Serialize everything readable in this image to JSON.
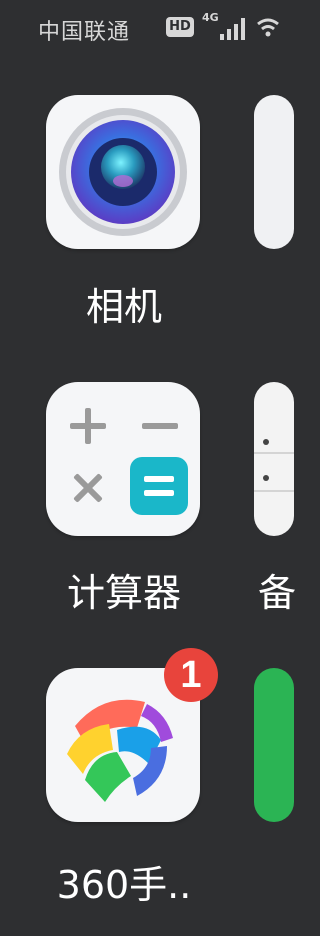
{
  "status_bar": {
    "carrier": "中国联通",
    "hd_badge": "HD",
    "network_type": "4G",
    "signal_icon": "signal-bars-icon",
    "wifi_icon": "wifi-icon"
  },
  "apps": [
    {
      "label": "相机",
      "icon": "camera-icon"
    },
    {
      "label": "计算器",
      "icon": "calculator-icon"
    },
    {
      "label": "360手..",
      "icon": "360-app-icon",
      "badge": "1"
    }
  ],
  "partial_apps": [
    {
      "icon": "partial-app-icon-1"
    },
    {
      "label": "备",
      "icon": "notes-icon"
    },
    {
      "icon": "green-app-icon"
    }
  ],
  "colors": {
    "background": "#2e2f31",
    "badge": "#e8443c",
    "calculator_teal": "#1ab7c9"
  }
}
